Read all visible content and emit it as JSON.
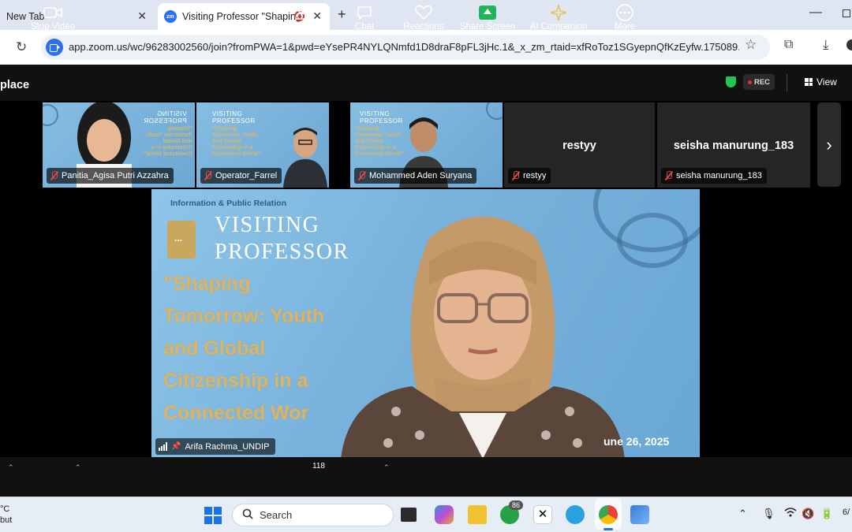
{
  "browser": {
    "tabs": [
      {
        "title": "New Tab",
        "active": false
      },
      {
        "title": "Visiting Professor \"Shaping",
        "active": true
      }
    ],
    "favicon_text": "zm",
    "address": "app.zoom.us/wc/96283002560/join?fromPWA=1&pwd=eYsePR4NYLQNmfd1D8draF8pFL3jHc.1&_x_zm_rtaid=xfRoToz1SGyepnQfKzEyfw.175089..."
  },
  "zoom": {
    "app_title": "place",
    "rec_label": "REC",
    "view_label": "View",
    "thumbnails": [
      {
        "name": "Panitia_Agisa Putri Azzahra",
        "type": "video"
      },
      {
        "name": "Operator_Farrel",
        "type": "video"
      },
      {
        "name": "Mohammed Aden Suryana",
        "type": "video"
      },
      {
        "name": "restyy",
        "type": "avatar",
        "big_name": "restyy"
      },
      {
        "name": "seisha manurung_183",
        "type": "avatar",
        "big_name": "seisha manurung_183"
      }
    ],
    "speaker": {
      "name": "Arifa Rachma_UNDIP",
      "slide_header": "Information & Public Relation",
      "slide_title_1": "VISITING",
      "slide_title_2": "PROFESSOR",
      "slide_quote": "\"Shaping\nTomorrow: Youth\nand Global\nCitizenship in a\nConnected Wor",
      "slide_date": "une 26, 2025"
    },
    "controls": {
      "stop_video": "Stop Video",
      "participants": "Participants",
      "participants_count": "118",
      "chat": "Chat",
      "reactions": "Reactions",
      "share_screen": "Share Screen",
      "ai_companion": "AI Companion",
      "more": "More"
    }
  },
  "taskbar": {
    "weather_line1": "°C",
    "weather_line2": "but",
    "search_placeholder": "Search",
    "whatsapp_badge": "86",
    "clock": "6/"
  }
}
